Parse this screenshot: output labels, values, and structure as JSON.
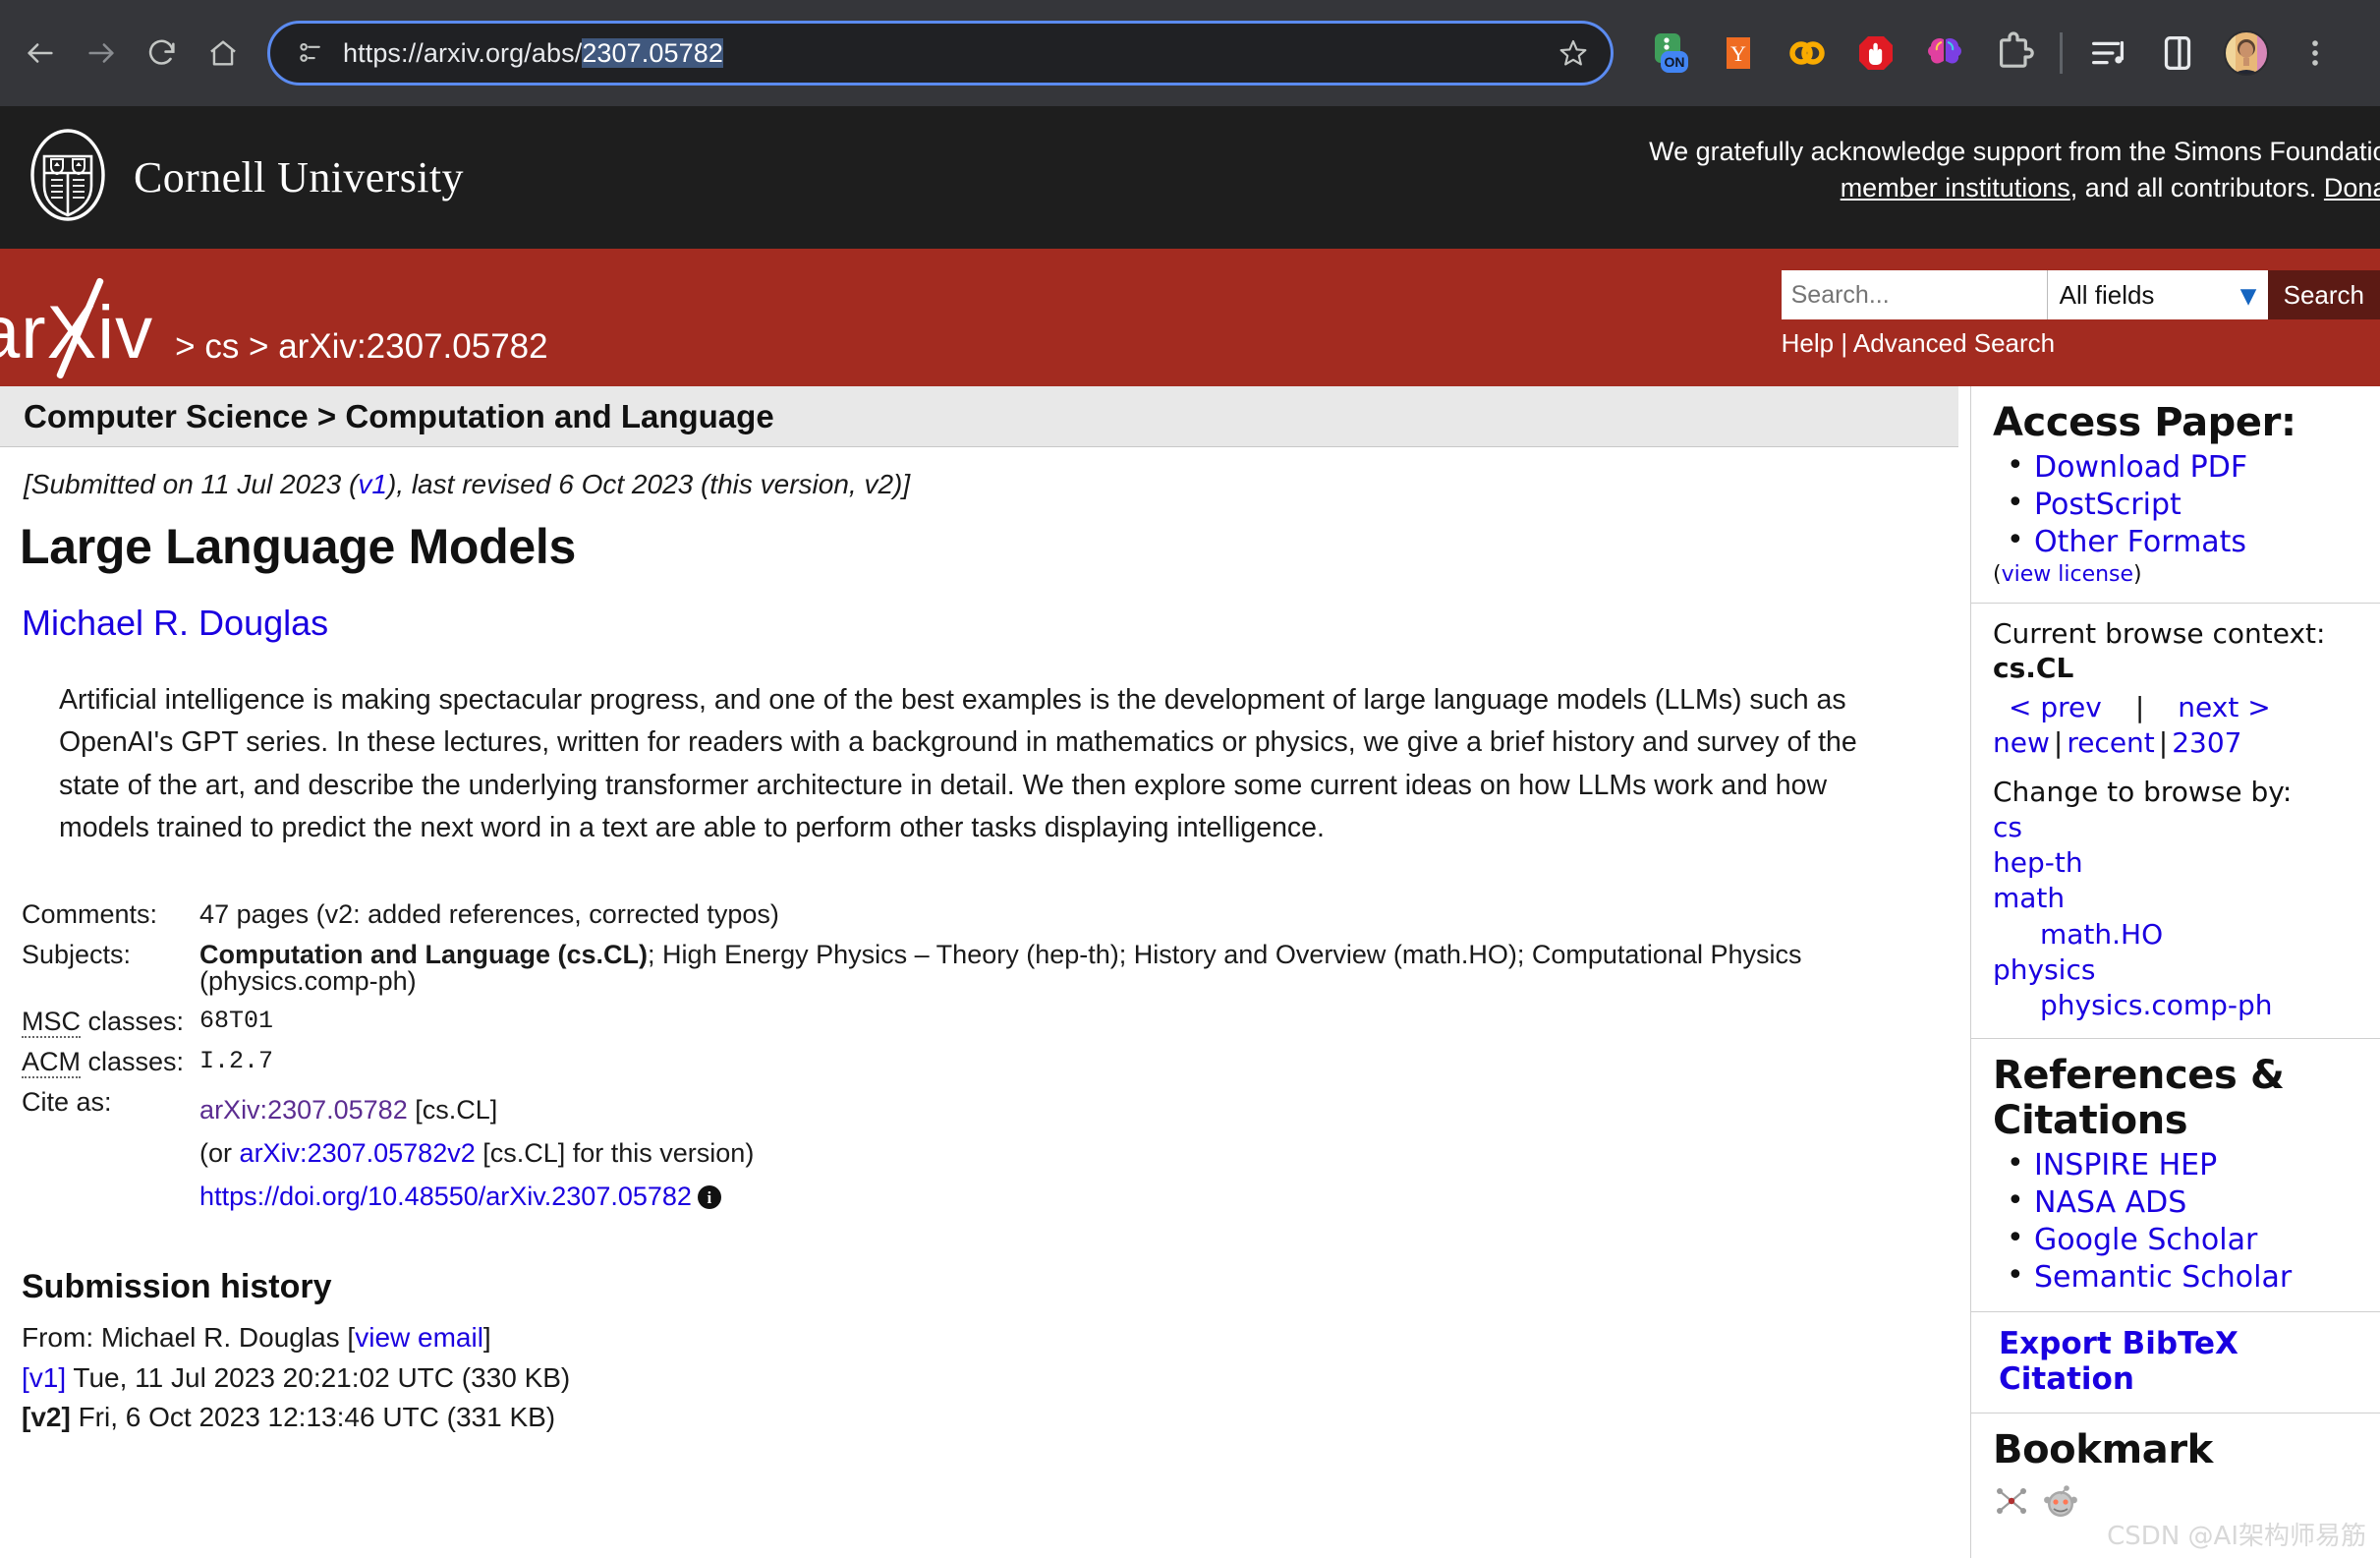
{
  "browser": {
    "nav": {
      "back_icon": "back-arrow-icon",
      "forward_icon": "forward-arrow-icon",
      "reload_icon": "reload-icon",
      "home_icon": "home-icon"
    },
    "omnibox": {
      "site_info_icon": "site-info-icon",
      "url_prefix": "https://arxiv.org/abs/",
      "url_selected": "2307.05782",
      "full_url": "https://arxiv.org/abs/2307.05782",
      "bookmark_icon": "star-icon"
    },
    "extensions": [
      {
        "name": "extension-icon-on-toggle",
        "label": "ON"
      },
      {
        "name": "extension-icon-y-orange",
        "label": "Y"
      },
      {
        "name": "extension-icon-colab",
        "label": "CO"
      },
      {
        "name": "extension-icon-adblock-hand",
        "label": ""
      },
      {
        "name": "extension-icon-brain",
        "label": ""
      },
      {
        "name": "extension-icon-puzzle-extensions",
        "label": ""
      }
    ],
    "toolbar_right": [
      {
        "name": "media-playlist-icon"
      },
      {
        "name": "side-panel-icon"
      },
      {
        "name": "profile-avatar"
      },
      {
        "name": "chrome-menu-icon"
      }
    ]
  },
  "cornell": {
    "logo_alt": "Cornell University crest",
    "name": "Cornell University",
    "support_line1": "We gratefully acknowledge support from the Simons Foundation,",
    "support_line2_link1": "member institutions",
    "support_line2_mid": ", and all contributors. ",
    "support_line2_link2": "Donate"
  },
  "arxiv_banner": {
    "logo": "arXiv",
    "breadcrumb": "> cs > arXiv:2307.05782",
    "search": {
      "placeholder": "Search...",
      "value": "",
      "field_selected": "All fields",
      "chevron_icon": "chevron-down-icon",
      "button_label": "Search",
      "help_label": "Help",
      "separator": "|",
      "advanced_label": "Advanced Search"
    }
  },
  "paper": {
    "subject_bar": "Computer Science > Computation and Language",
    "dateline_pre": "[Submitted on 11 Jul 2023 (",
    "dateline_v1": "v1",
    "dateline_post": "), last revised 6 Oct 2023 (this version, v2)]",
    "title": "Large Language Models",
    "authors": "Michael R. Douglas",
    "abstract": "Artificial intelligence is making spectacular progress, and one of the best examples is the development of large language models (LLMs) such as OpenAI's GPT series. In these lectures, written for readers with a background in mathematics or physics, we give a brief history and survey of the state of the art, and describe the underlying transformer architecture in detail. We then explore some current ideas on how LLMs work and how models trained to predict the next word in a text are able to perform other tasks displaying intelligence.",
    "meta": {
      "comments_label": "Comments:",
      "comments_value": "47 pages (v2: added references, corrected typos)",
      "subjects_label": "Subjects:",
      "subjects_primary": "Computation and Language (cs.CL)",
      "subjects_rest": "; High Energy Physics – Theory (hep-th); History and Overview (math.HO); Computational Physics (physics.comp-ph)",
      "msc_label_abbr": "MSC",
      "msc_label_rest": " classes:",
      "msc_value": "68T01",
      "acm_label_abbr": "ACM",
      "acm_label_rest": " classes:",
      "acm_value": "I.2.7",
      "cite_label": "Cite as:",
      "cite_line1_link": "arXiv:2307.05782",
      "cite_line1_rest": " [cs.CL]",
      "cite_line2_pre": "(or ",
      "cite_line2_link": "arXiv:2307.05782v2",
      "cite_line2_rest": " [cs.CL] for this version)",
      "cite_doi_link": "https://doi.org/10.48550/arXiv.2307.05782",
      "cite_doi_info_icon": "info-icon"
    },
    "submission_history": {
      "title": "Submission history",
      "from_pre": "From: Michael R. Douglas [",
      "from_link": "view email",
      "from_post": "]",
      "versions": [
        {
          "tag": "[v1]",
          "tag_is_link": true,
          "text": " Tue, 11 Jul 2023 20:21:02 UTC (330 KB)"
        },
        {
          "tag": "[v2]",
          "tag_is_link": false,
          "text": " Fri, 6 Oct 2023 12:13:46 UTC (331 KB)"
        }
      ]
    }
  },
  "sidebar": {
    "access": {
      "title": "Access Paper:",
      "links": [
        "Download PDF",
        "PostScript",
        "Other Formats"
      ],
      "license_pre": "(",
      "license_link": "view license",
      "license_post": ")"
    },
    "browse": {
      "context_label": "Current browse context:",
      "context_value": "cs.CL",
      "prev_label": "< prev",
      "separator": "|",
      "next_label": "next >",
      "new_label": "new",
      "recent_label": "recent",
      "month_label": "2307",
      "change_label": "Change to browse by:",
      "categories": [
        {
          "label": "cs",
          "sub": null
        },
        {
          "label": "hep-th",
          "sub": null
        },
        {
          "label": "math",
          "sub": "math.HO"
        },
        {
          "label": "physics",
          "sub": "physics.comp-ph"
        }
      ]
    },
    "references": {
      "title": "References & Citations",
      "links": [
        "INSPIRE HEP",
        "NASA ADS",
        "Google Scholar",
        "Semantic Scholar"
      ]
    },
    "export": {
      "label": "Export BibTeX Citation"
    },
    "bookmark": {
      "title": "Bookmark",
      "icons": [
        "bibsonomy-icon",
        "reddit-icon"
      ]
    }
  },
  "watermark": "CSDN @AI架构师易筋",
  "colors": {
    "arxiv_red": "#a32b20",
    "link_blue": "#1a00e0",
    "link_visited_purple": "#5c2d91",
    "chrome_bg": "#35363a",
    "cornell_bg": "#1e1e1e"
  }
}
